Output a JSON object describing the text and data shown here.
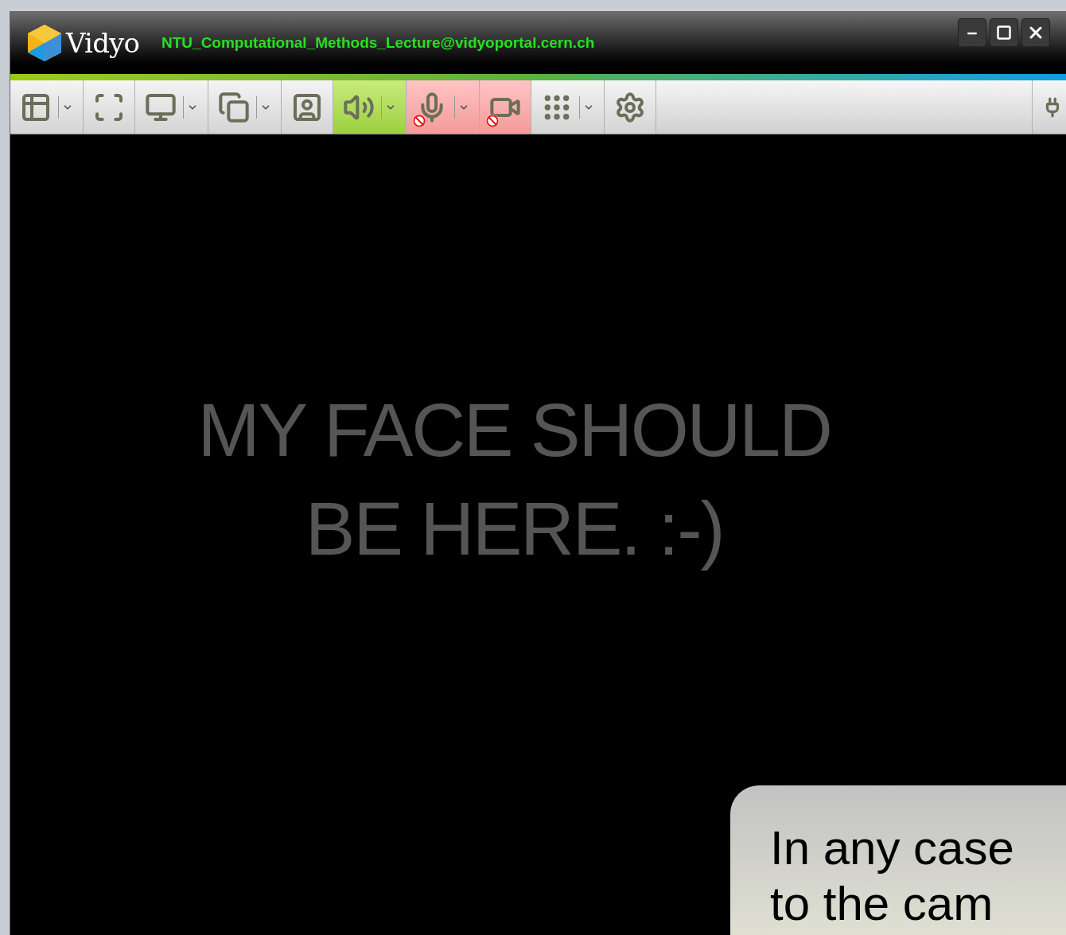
{
  "window": {
    "app_name": "Vidyo",
    "title": "NTU_Computational_Methods_Lecture@vidyoportal.cern.ch"
  },
  "toolbar": {
    "buttons": [
      {
        "kind": "layout",
        "active": false,
        "muted": false,
        "dropdown": true
      },
      {
        "kind": "fullscreen",
        "active": false,
        "muted": false,
        "dropdown": false
      },
      {
        "kind": "monitor",
        "active": false,
        "muted": false,
        "dropdown": true
      },
      {
        "kind": "share",
        "active": false,
        "muted": false,
        "dropdown": true
      },
      {
        "kind": "selfview",
        "active": false,
        "muted": false,
        "dropdown": false
      },
      {
        "kind": "speaker",
        "active": true,
        "muted": false,
        "dropdown": true
      },
      {
        "kind": "microphone",
        "active": false,
        "muted": true,
        "dropdown": true
      },
      {
        "kind": "camera",
        "active": false,
        "muted": true,
        "dropdown": false
      },
      {
        "kind": "dialpad",
        "active": false,
        "muted": false,
        "dropdown": true
      },
      {
        "kind": "settings",
        "active": false,
        "muted": false,
        "dropdown": false
      }
    ]
  },
  "video": {
    "message_lines": [
      "MY FACE SHOULD",
      "BE HERE. :-)"
    ]
  },
  "callout": {
    "lines": [
      "In any case",
      "to the cam"
    ]
  }
}
